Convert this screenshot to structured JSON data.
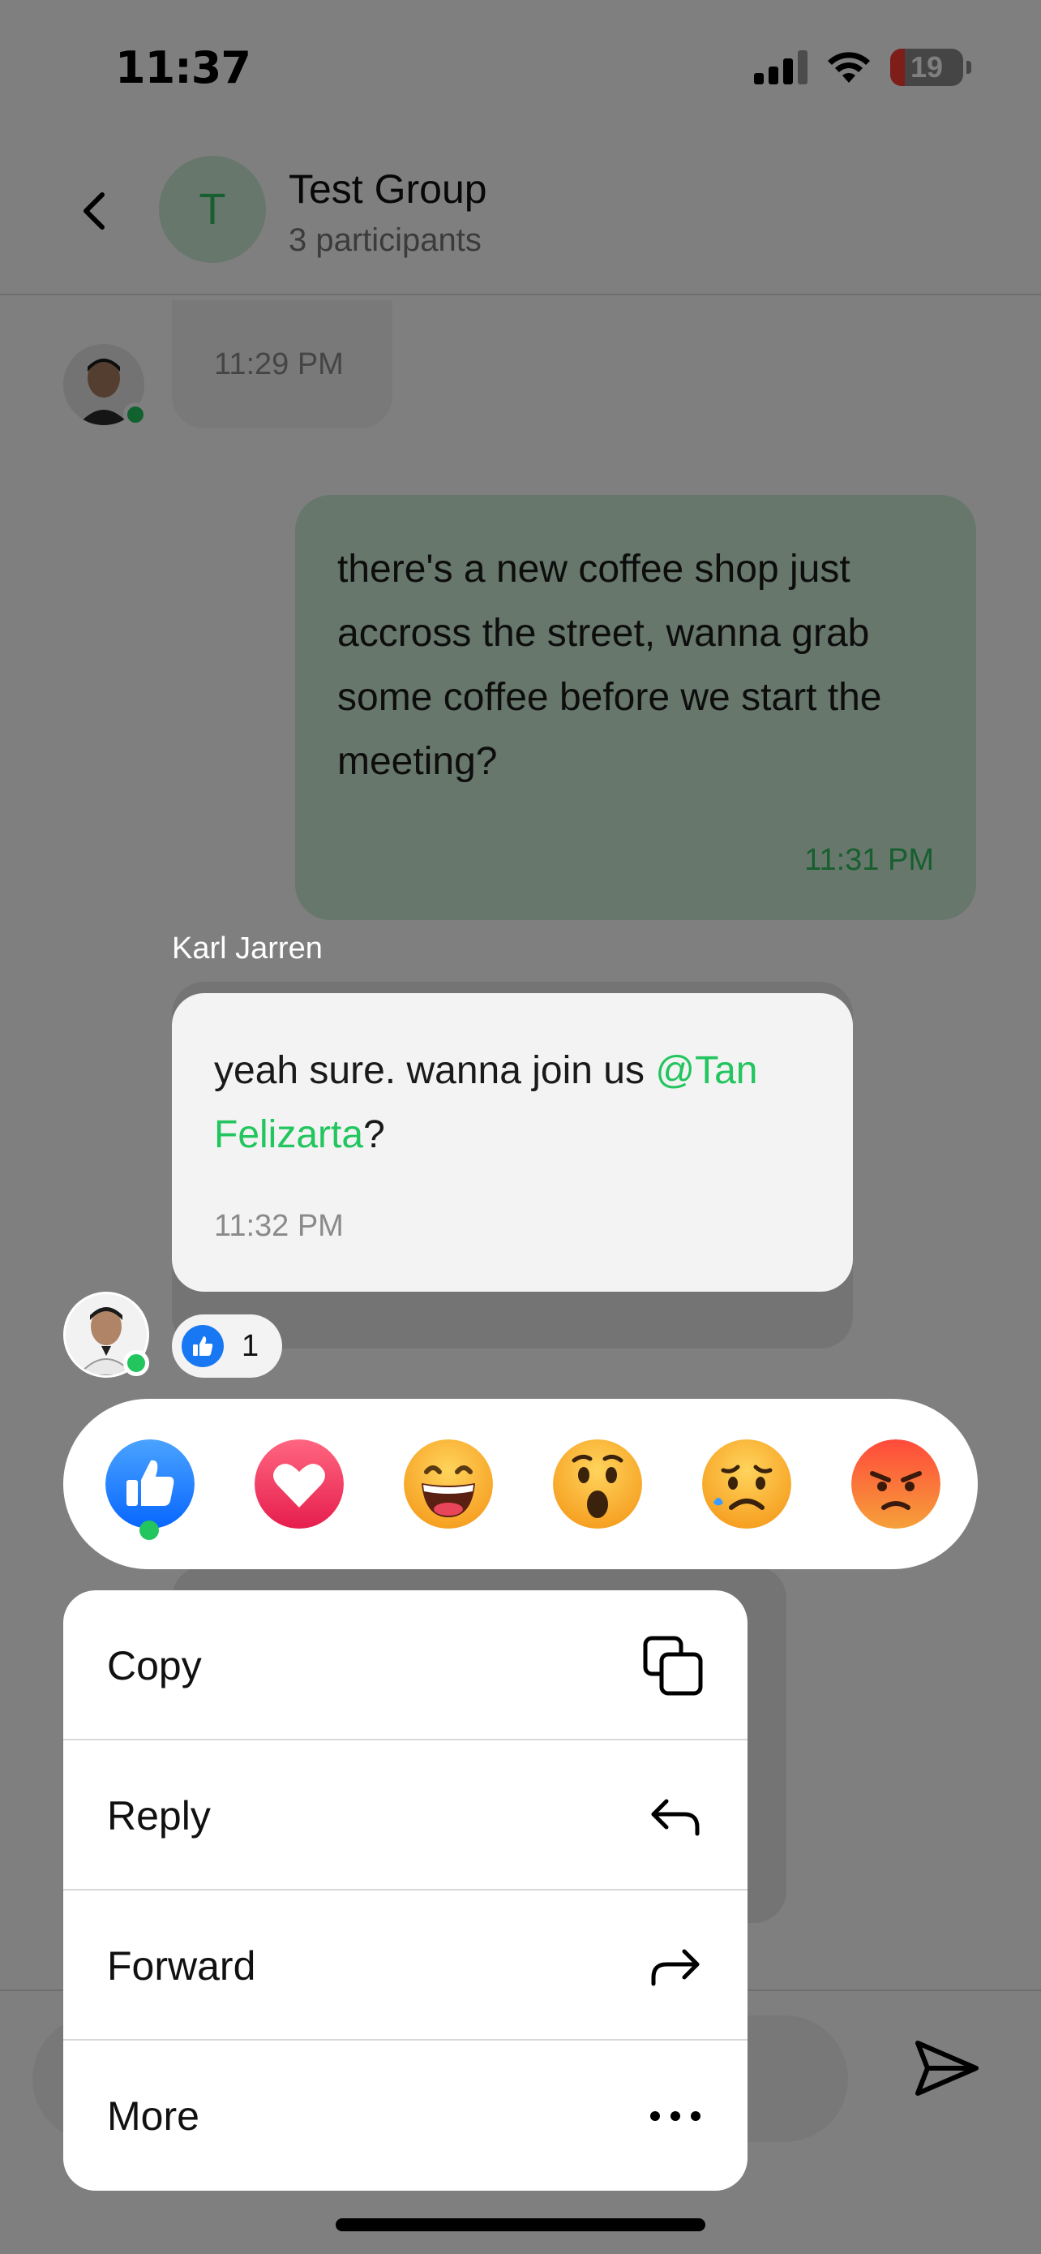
{
  "status_bar": {
    "time": "11:37",
    "battery": "19"
  },
  "header": {
    "avatar_letter": "T",
    "title": "Test Group",
    "subtitle": "3 participants"
  },
  "messages": [
    {
      "time": "11:29 PM"
    },
    {
      "text": "there's a new coffee shop just accross the street, wanna grab some coffee before we start the meeting?",
      "time": "11:31 PM"
    },
    {
      "sender": "Karl Jarren",
      "text_before": "yeah sure. wanna join us ",
      "mention": "@Tan Felizarta",
      "text_after": "?",
      "time": "11:32 PM",
      "reaction_count": "1"
    }
  ],
  "reactions": [
    "like",
    "heart",
    "grin",
    "wow",
    "sad",
    "angry"
  ],
  "menu": {
    "items": [
      {
        "label": "Copy",
        "icon": "copy-icon"
      },
      {
        "label": "Reply",
        "icon": "reply-icon"
      },
      {
        "label": "Forward",
        "icon": "forward-icon"
      },
      {
        "label": "More",
        "icon": "more-icon"
      }
    ]
  },
  "colors": {
    "accent": "#22c55e",
    "like": "#1877f2",
    "heart": "#e53e5b",
    "outgoing_bubble": "#cfeed9"
  }
}
